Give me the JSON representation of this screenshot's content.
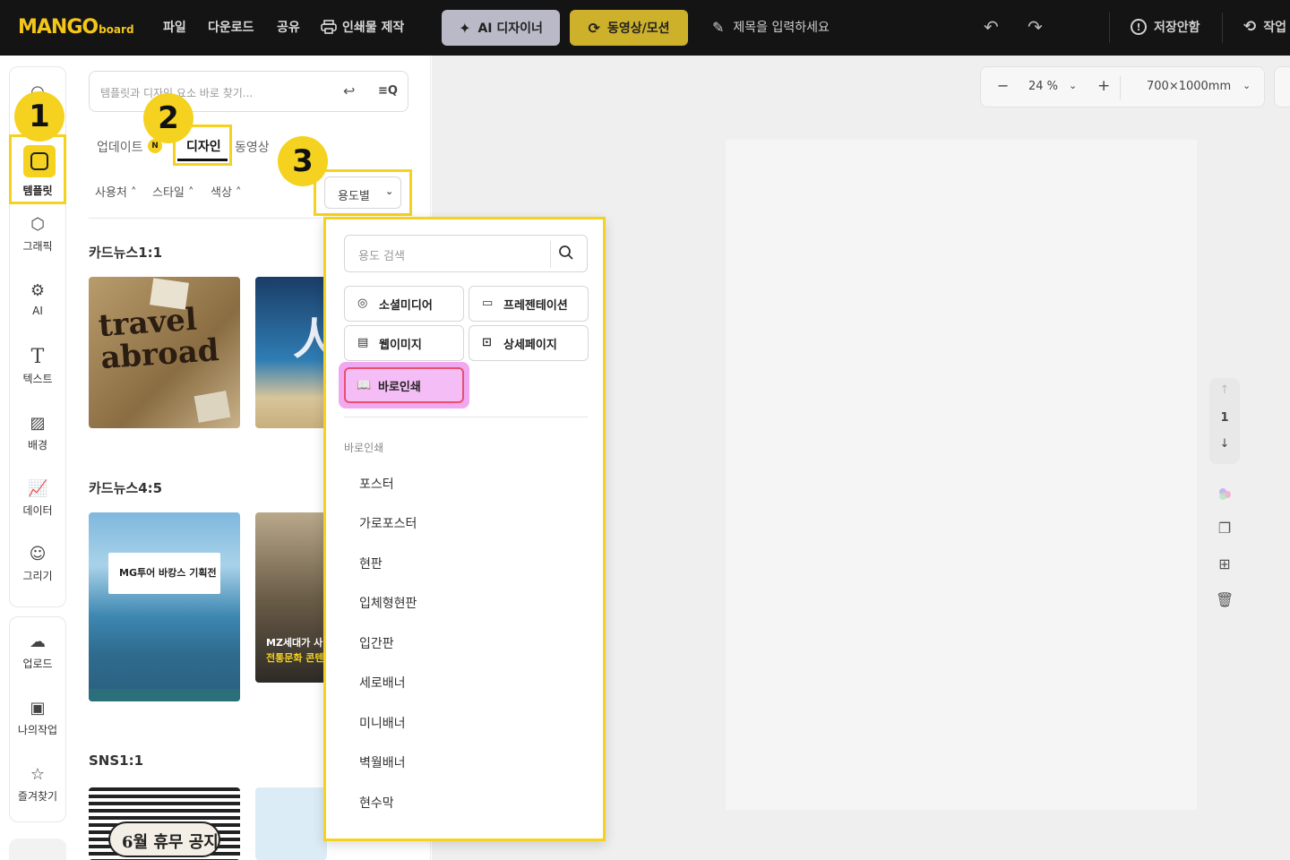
{
  "topbar": {
    "logo_main": "MANGO",
    "logo_sub": "board",
    "menu": [
      "파일",
      "다운로드",
      "공유",
      "인쇄물 제작"
    ],
    "ai_button": "AI 디자이너",
    "video_button": "동영상/모션",
    "title_placeholder": "제목을 입력하세요",
    "save_status": "저장안함",
    "work_label": "작업"
  },
  "rail": {
    "items": [
      "템플릿",
      "그래픽",
      "AI",
      "텍스트",
      "배경",
      "데이터",
      "그리기"
    ],
    "items2": [
      "업로드",
      "나의작업",
      "즐겨찾기"
    ]
  },
  "panel": {
    "search_placeholder": "템플릿과 디자인 요소 바로 찾기...",
    "tabs": [
      "업데이트",
      "디자인",
      "동영상"
    ],
    "update_badge": "N",
    "filters": [
      "사용처",
      "스타일",
      "색상"
    ],
    "usage_dropdown": "용도별",
    "sections": [
      "카드뉴스1:1",
      "카드뉴스4:5",
      "SNS1:1"
    ],
    "thumb_texts": {
      "travel": "travel abroad",
      "mgtour": "MG투어 바캉스 기획전",
      "mz": "MZ세대가 사",
      "mz2": "전통문화 콘텐",
      "notice": "6월 휴무 공지"
    }
  },
  "steps": [
    "1",
    "2",
    "3"
  ],
  "dropdown": {
    "search_placeholder": "용도 검색",
    "chips": [
      "소셜미디어",
      "프레젠테이션",
      "웹이미지",
      "상세페이지",
      "바로인쇄"
    ],
    "selected_chip": "바로인쇄",
    "section_title": "바로인쇄",
    "items": [
      "포스터",
      "가로포스터",
      "현판",
      "입체형현판",
      "입간판",
      "세로배너",
      "미니배너",
      "벽월배너",
      "현수막"
    ]
  },
  "canvas": {
    "zoom": "24 %",
    "size": "700×1000mm",
    "page_number": "1"
  },
  "colors": {
    "highlight": "#f5d21f",
    "topbar": "#141414",
    "selected_chip": "#f0a8f0"
  }
}
